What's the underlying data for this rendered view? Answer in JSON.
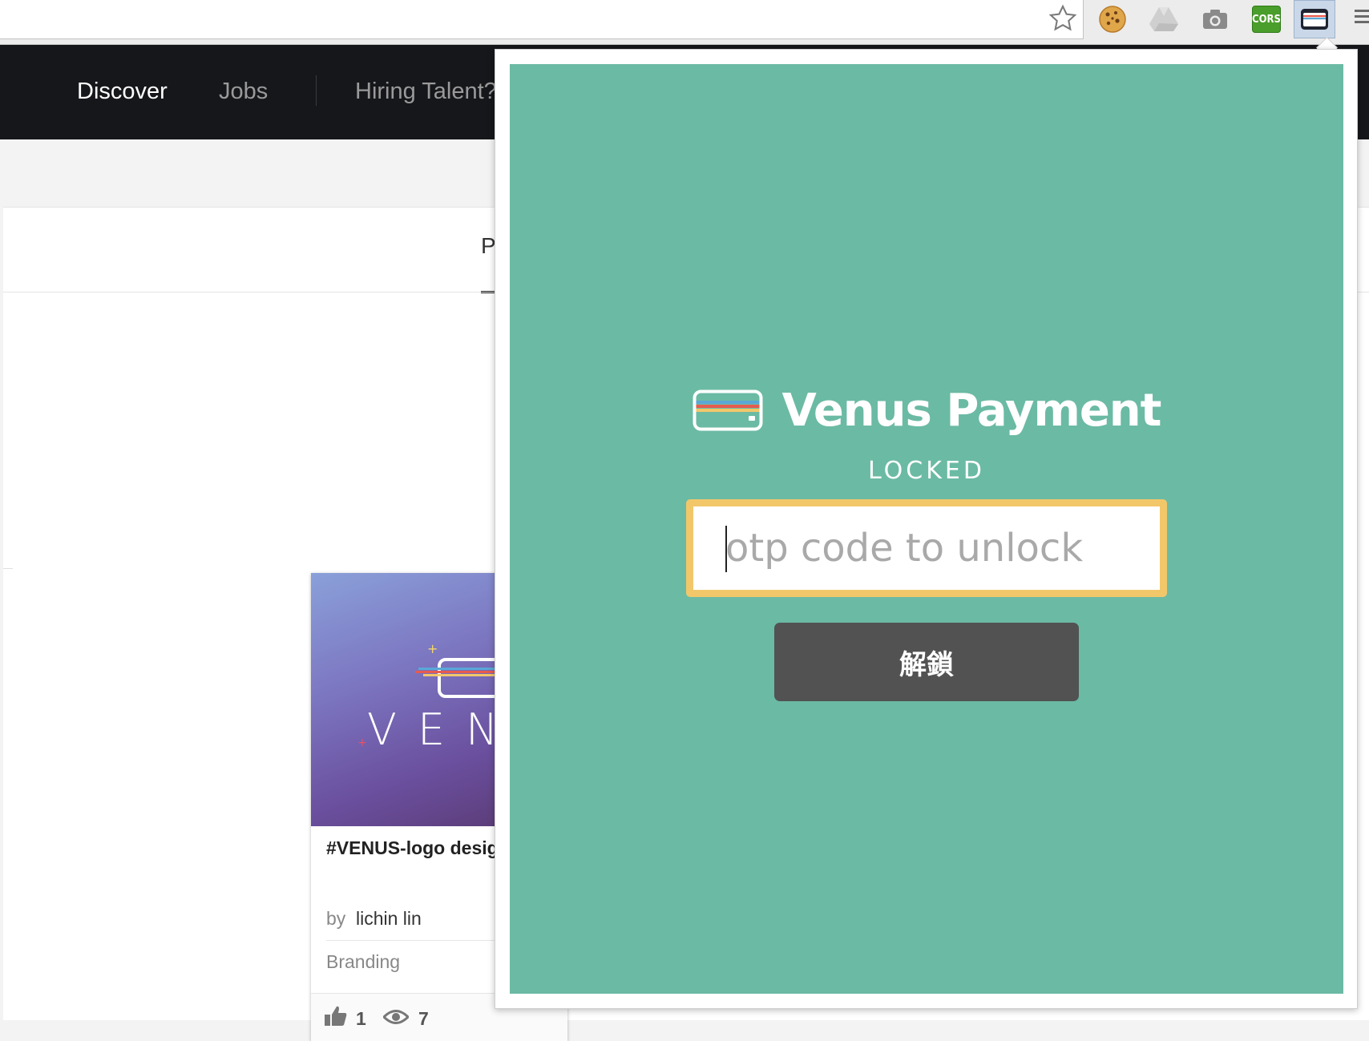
{
  "browser": {
    "extensions": {
      "cors_label": "CORS"
    }
  },
  "site_nav": {
    "items": [
      {
        "label": "Discover",
        "active": true
      },
      {
        "label": "Jobs",
        "active": false
      },
      {
        "label": "Hiring Talent?",
        "active": false
      }
    ]
  },
  "page": {
    "tab_partial": "P",
    "card": {
      "thumb_word": "VEN",
      "title": "#VENUS-logo desig",
      "by_label": "by",
      "author": "lichin lin",
      "category": "Branding",
      "likes": "1",
      "views": "7"
    }
  },
  "popup": {
    "brand": "Venus Payment",
    "status": "LOCKED",
    "otp_placeholder": "otp code to unlock",
    "unlock_label": "解鎖",
    "colors": {
      "background": "#6bbaa4",
      "input_border": "#f2c76a",
      "button": "#525252"
    }
  }
}
